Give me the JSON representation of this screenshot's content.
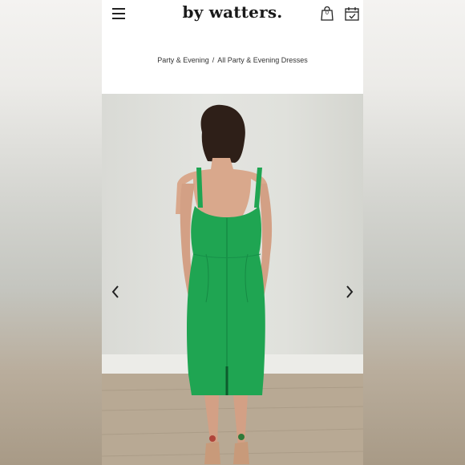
{
  "header": {
    "logo": "by watters.",
    "menu_icon": "hamburger-menu-icon",
    "bag_icon": "shopping-bag-icon",
    "bag_count": "0",
    "calendar_icon": "calendar-appointment-icon"
  },
  "breadcrumb": {
    "items": [
      "Party & Evening",
      "All Party & Evening Dresses"
    ],
    "separator": "/"
  },
  "gallery": {
    "prev_icon": "chevron-left-icon",
    "next_icon": "chevron-right-icon",
    "dress_color": "#1fa552"
  }
}
